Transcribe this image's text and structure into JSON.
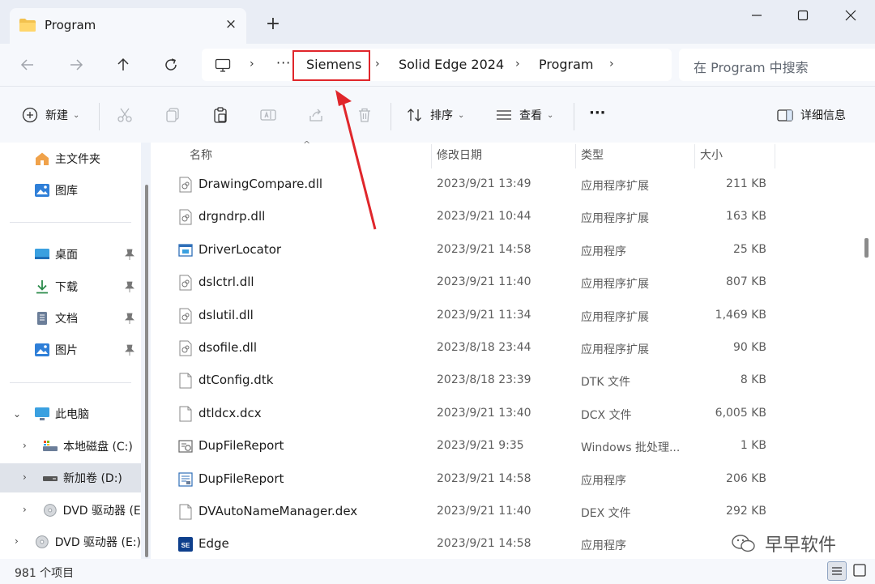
{
  "window": {
    "tab_title": "Program",
    "tab_close": "×",
    "new_tab": "+"
  },
  "address": {
    "ellipsis": "···",
    "crumbs": [
      "Siemens",
      "Solid Edge 2024",
      "Program"
    ],
    "separator": "›",
    "search_placeholder": "在 Program 中搜索"
  },
  "commands": {
    "new_label": "新建",
    "sort_label": "排序",
    "view_label": "查看",
    "more_label": "···",
    "details_label": "详细信息"
  },
  "sidebar": {
    "quick": [
      {
        "label": "主文件夹",
        "icon": "home-icon"
      },
      {
        "label": "图库",
        "icon": "gallery-icon"
      }
    ],
    "pinned": [
      {
        "label": "桌面",
        "icon": "desktop-icon"
      },
      {
        "label": "下载",
        "icon": "download-icon"
      },
      {
        "label": "文档",
        "icon": "document-icon"
      },
      {
        "label": "图片",
        "icon": "pictures-icon"
      }
    ],
    "this_pc": "此电脑",
    "drives": [
      {
        "label": "本地磁盘 (C:)"
      },
      {
        "label": "新加卷 (D:)"
      },
      {
        "label": "DVD 驱动器 (E"
      },
      {
        "label": "DVD 驱动器 (E:)"
      }
    ]
  },
  "columns": {
    "name": "名称",
    "modified": "修改日期",
    "type": "类型",
    "size": "大小"
  },
  "files": [
    {
      "name": "DrawingCompare.dll",
      "date": "2023/9/21 13:49",
      "type": "应用程序扩展",
      "size": "211 KB",
      "icon": "dll-icon"
    },
    {
      "name": "drgndrp.dll",
      "date": "2023/9/21 10:44",
      "type": "应用程序扩展",
      "size": "163 KB",
      "icon": "dll-icon"
    },
    {
      "name": "DriverLocator",
      "date": "2023/9/21 14:58",
      "type": "应用程序",
      "size": "25 KB",
      "icon": "exe-icon"
    },
    {
      "name": "dslctrl.dll",
      "date": "2023/9/21 11:40",
      "type": "应用程序扩展",
      "size": "807 KB",
      "icon": "dll-icon"
    },
    {
      "name": "dslutil.dll",
      "date": "2023/9/21 11:34",
      "type": "应用程序扩展",
      "size": "1,469 KB",
      "icon": "dll-icon"
    },
    {
      "name": "dsofile.dll",
      "date": "2023/8/18 23:44",
      "type": "应用程序扩展",
      "size": "90 KB",
      "icon": "dll-icon"
    },
    {
      "name": "dtConfig.dtk",
      "date": "2023/8/18 23:39",
      "type": "DTK 文件",
      "size": "8 KB",
      "icon": "file-icon"
    },
    {
      "name": "dtldcx.dcx",
      "date": "2023/9/21 13:40",
      "type": "DCX 文件",
      "size": "6,005 KB",
      "icon": "file-icon"
    },
    {
      "name": "DupFileReport",
      "date": "2023/9/21 9:35",
      "type": "Windows 批处理...",
      "size": "1 KB",
      "icon": "batch-icon"
    },
    {
      "name": "DupFileReport",
      "date": "2023/9/21 14:58",
      "type": "应用程序",
      "size": "206 KB",
      "icon": "report-exe-icon"
    },
    {
      "name": "DVAutoNameManager.dex",
      "date": "2023/9/21 11:40",
      "type": "DEX 文件",
      "size": "292 KB",
      "icon": "file-icon"
    },
    {
      "name": "Edge",
      "date": "2023/9/21 14:58",
      "type": "应用程序",
      "size": "",
      "icon": "solid-edge-icon"
    }
  ],
  "status": {
    "item_count": "981 个项目"
  },
  "watermark": "早早软件",
  "colors": {
    "highlight": "#e0262b",
    "accent": "#0067c0"
  }
}
